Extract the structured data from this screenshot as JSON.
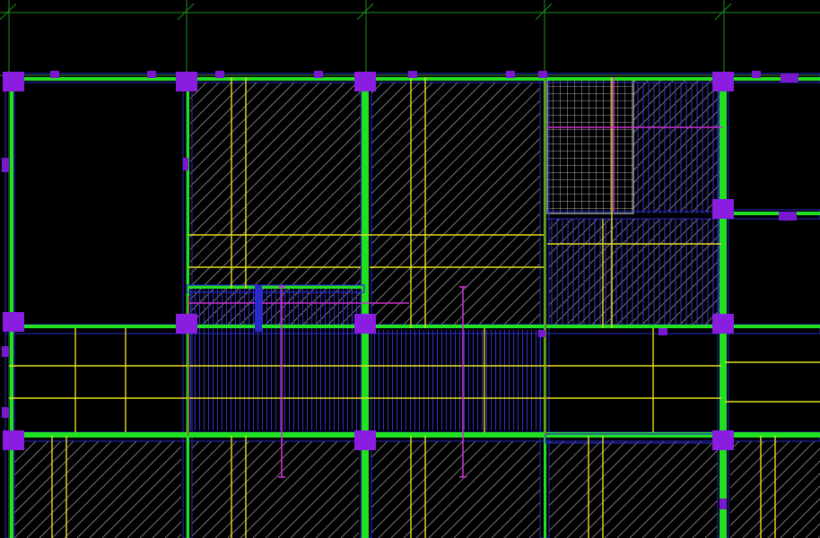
{
  "drawing": {
    "type": "cad-structural-floor-plan",
    "background_color": "#000000",
    "colors": {
      "grid_axis": "#1f8f1f",
      "beam": "#22e022",
      "beam_outline": "#2020c0",
      "column": "#8a1de0",
      "column_small": "#7a18d0",
      "hatch_diagonal": "#9a9a9a",
      "hatch_blue": "#3a3ad8",
      "grid_mesh": "#e8e8e8",
      "rebar_yellow": "#e8e020",
      "rebar_magenta": "#d030d0",
      "section_red": "#c02020"
    },
    "legend": null
  }
}
